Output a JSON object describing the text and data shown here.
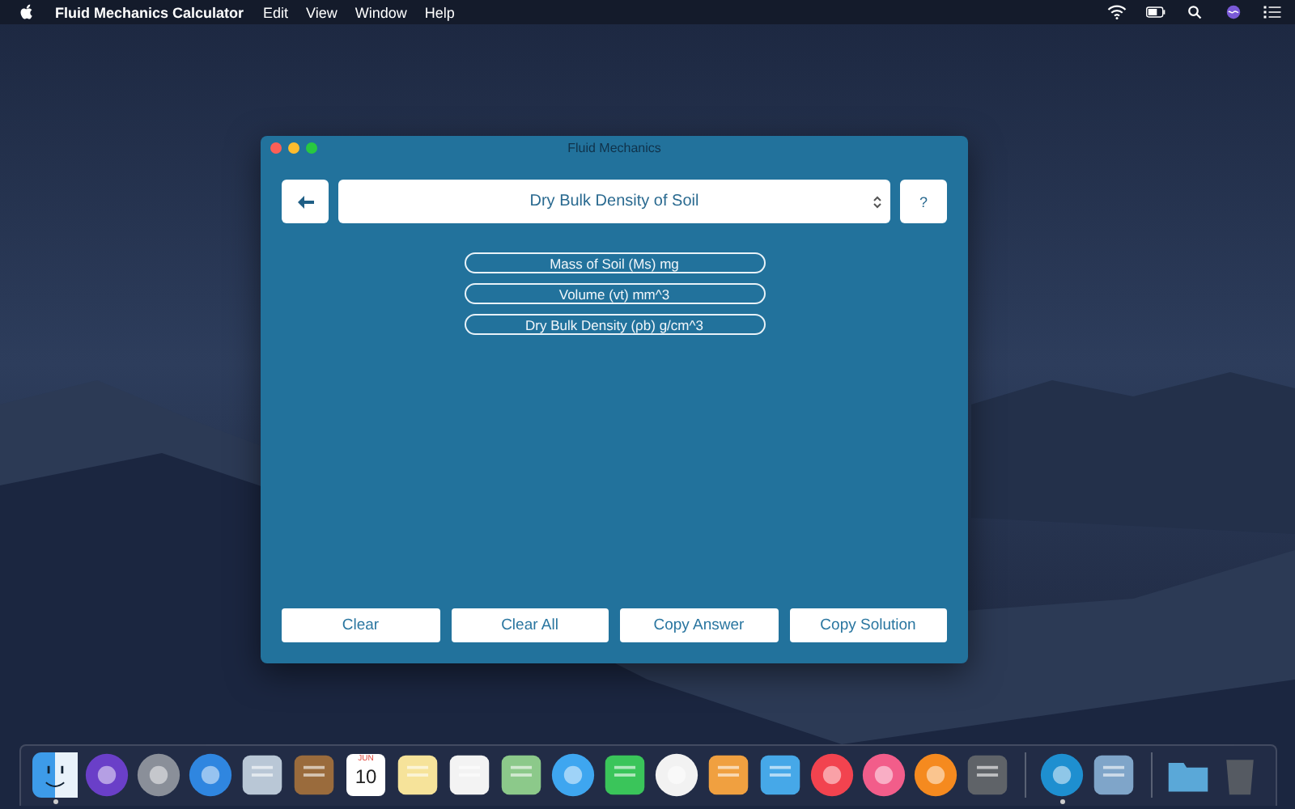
{
  "menu_bar": {
    "app_name": "Fluid Mechanics Calculator",
    "items": [
      "Edit",
      "View",
      "Window",
      "Help"
    ]
  },
  "window": {
    "title": "Fluid Mechanics",
    "toolbar": {
      "dropdown": {
        "value": "Dry Bulk Density of Soil"
      },
      "help_button": "?"
    },
    "fields": [
      {
        "placeholder": "Mass of Soil (Ms) mg"
      },
      {
        "placeholder": "Volume (vt) mm^3"
      },
      {
        "placeholder": "Dry Bulk Density (ρb) g/cm^3"
      }
    ],
    "buttons": [
      "Clear",
      "Clear All",
      "Copy Answer",
      "Copy Solution"
    ]
  },
  "dock": {
    "sections": [
      {
        "apps": [
          {
            "kind": "face",
            "color": "#3d9be9",
            "running": true
          },
          {
            "kind": "circle",
            "color": "#6a3fc8",
            "running": false
          },
          {
            "kind": "circle",
            "color": "#8a8f99",
            "running": false
          },
          {
            "kind": "circle",
            "color": "#2f86e0",
            "running": false
          },
          {
            "kind": "square",
            "color": "#b9c7d6",
            "running": false
          },
          {
            "kind": "square",
            "color": "#9a6b3c",
            "running": false
          },
          {
            "kind": "calendar",
            "color": "#ffffff",
            "running": false,
            "month": "JUN",
            "day": "10"
          },
          {
            "kind": "square",
            "color": "#f6e39a",
            "running": false
          },
          {
            "kind": "square",
            "color": "#f3f3f3",
            "running": false
          },
          {
            "kind": "square",
            "color": "#8cc98a",
            "running": false
          },
          {
            "kind": "circle",
            "color": "#3ea6f0",
            "running": false
          },
          {
            "kind": "square",
            "color": "#3ac55a",
            "running": false
          },
          {
            "kind": "circle",
            "color": "#f2f2f2",
            "running": false
          },
          {
            "kind": "square",
            "color": "#f0a040",
            "running": false
          },
          {
            "kind": "square",
            "color": "#46a8e8",
            "running": false
          },
          {
            "kind": "circle",
            "color": "#f2434f",
            "running": false
          },
          {
            "kind": "circle",
            "color": "#f25d8a",
            "running": false
          },
          {
            "kind": "circle",
            "color": "#f58a1f",
            "running": false
          },
          {
            "kind": "square",
            "color": "#5f6368",
            "running": false
          }
        ]
      },
      {
        "apps": [
          {
            "kind": "circle",
            "color": "#1e8fd0",
            "running": true
          },
          {
            "kind": "square",
            "color": "#7fa5c9",
            "running": false
          }
        ]
      },
      {
        "apps": [
          {
            "kind": "folder",
            "color": "#5aa8d8",
            "running": false
          },
          {
            "kind": "trash",
            "color": "#555a62",
            "running": false
          }
        ]
      }
    ]
  }
}
